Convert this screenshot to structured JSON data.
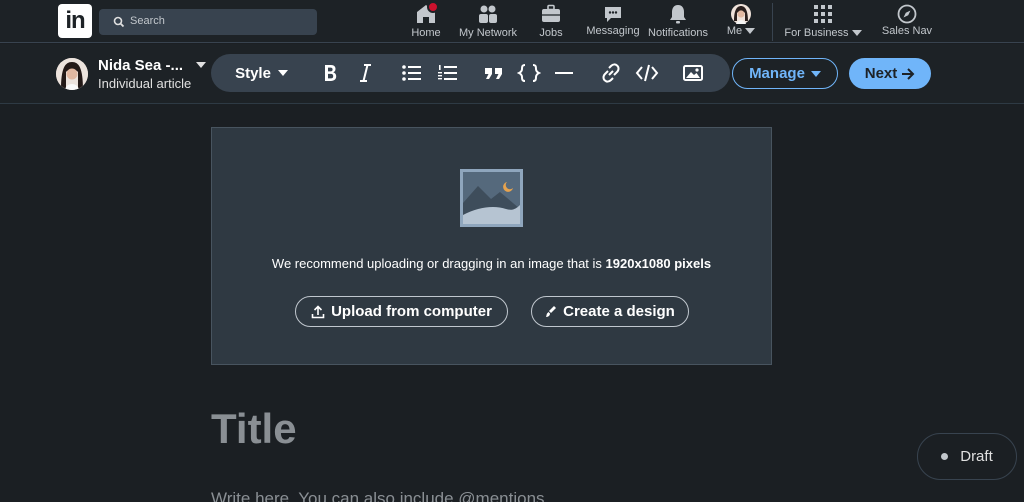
{
  "nav": {
    "logo_text": "in",
    "search_placeholder": "Search",
    "items": [
      {
        "label": "Home",
        "icon": "home-icon"
      },
      {
        "label": "My Network",
        "icon": "network-icon"
      },
      {
        "label": "Jobs",
        "icon": "briefcase-icon"
      },
      {
        "label": "Messaging",
        "icon": "chat-icon"
      },
      {
        "label": "Notifications",
        "icon": "bell-icon"
      },
      {
        "label": "Me",
        "icon": "avatar"
      },
      {
        "label": "For Business",
        "icon": "grid-icon"
      },
      {
        "label": "Sales Nav",
        "icon": "compass-icon"
      }
    ],
    "badge_color": "#cb112d"
  },
  "editor": {
    "author_name": "Nida Sea -...",
    "author_role": "Individual article",
    "style_label": "Style",
    "tools": [
      "bold-icon",
      "italic-icon",
      "bulleted-list-icon",
      "numbered-list-icon",
      "quote-icon",
      "code-block-icon",
      "divider-icon",
      "link-icon",
      "embed-icon",
      "image-icon"
    ],
    "manage_label": "Manage",
    "next_label": "Next",
    "accent_color": "#70b5f9"
  },
  "cover": {
    "recommend_text": "We recommend uploading or dragging in an image that is ",
    "recommend_size": "1920x1080 pixels",
    "upload_label": "Upload from computer",
    "design_label": "Create a design"
  },
  "article": {
    "title_placeholder": "Title",
    "body_placeholder": "Write here. You can also include @mentions."
  },
  "status": {
    "draft_label": "Draft"
  }
}
